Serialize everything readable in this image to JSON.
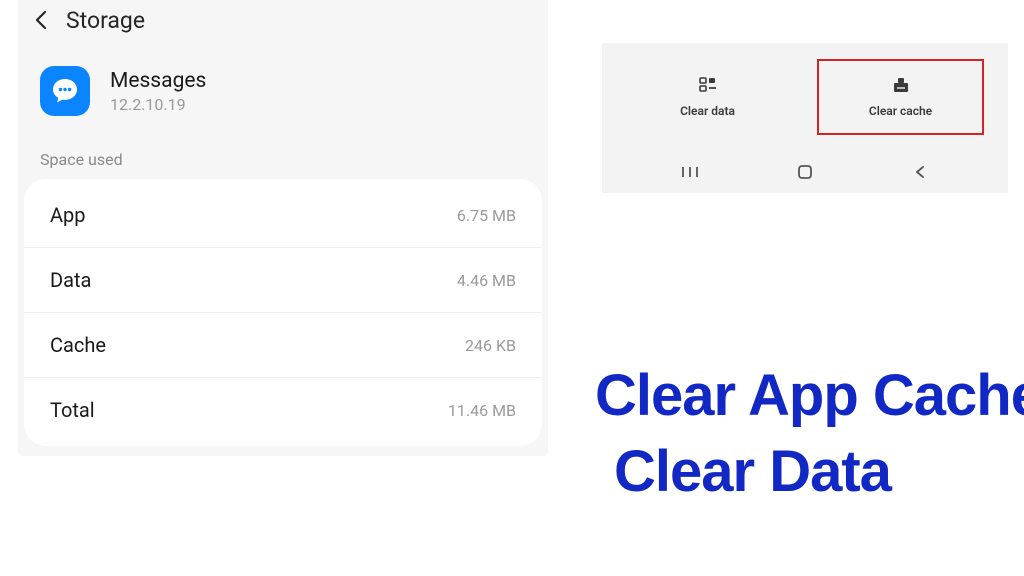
{
  "header": {
    "title": "Storage"
  },
  "app": {
    "name": "Messages",
    "version": "12.2.10.19"
  },
  "section_label": "Space used",
  "rows": [
    {
      "label": "App",
      "value": "6.75 MB"
    },
    {
      "label": "Data",
      "value": "4.46 MB"
    },
    {
      "label": "Cache",
      "value": "246 KB"
    },
    {
      "label": "Total",
      "value": "11.46 MB"
    }
  ],
  "actions": {
    "clear_data": "Clear data",
    "clear_cache": "Clear cache"
  },
  "annotation": {
    "line1": "Clear App Cache",
    "line2": "Clear Data"
  }
}
